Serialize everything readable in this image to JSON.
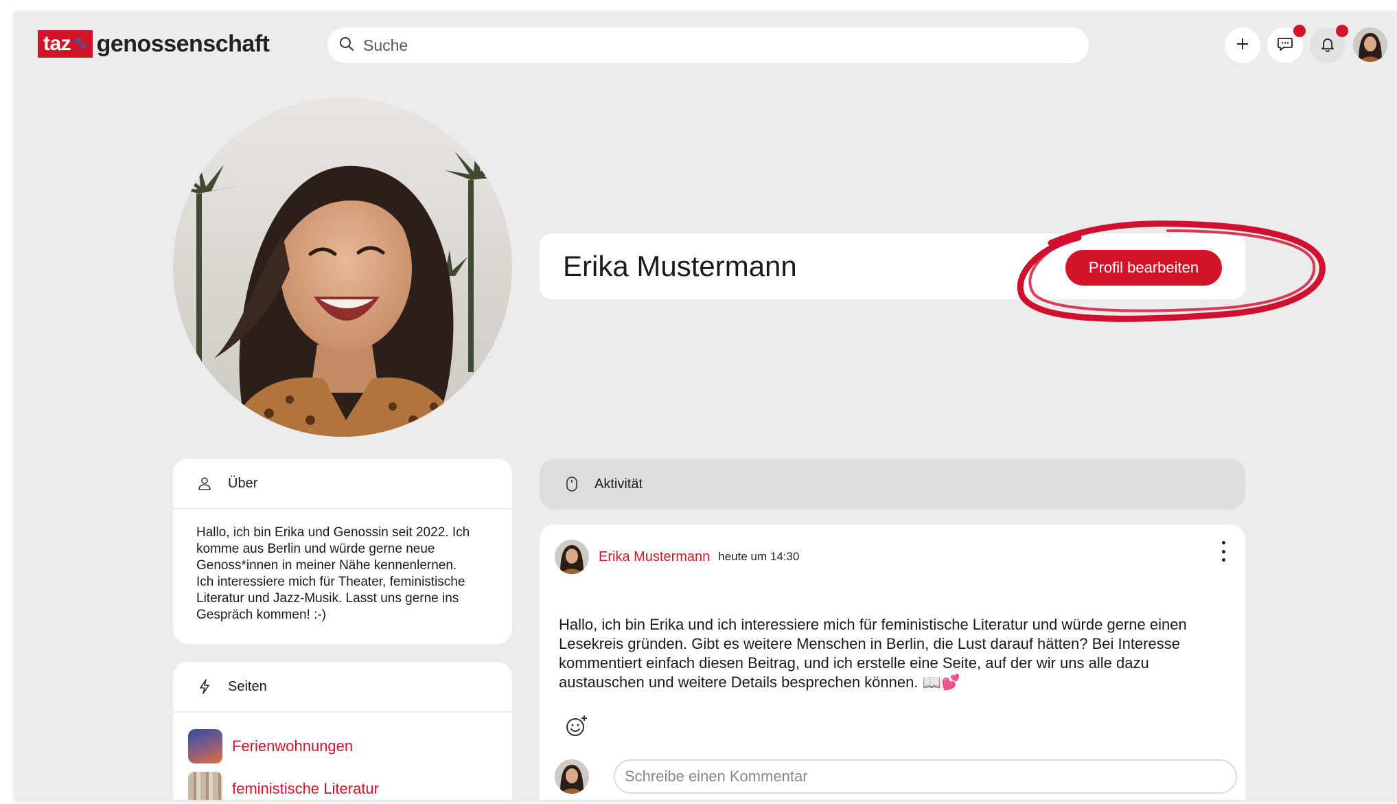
{
  "header": {
    "logo_taz": "taz",
    "logo_text": "genossenschaft",
    "search_placeholder": "Suche",
    "icons": [
      "plus-icon",
      "chat-icon",
      "bell-icon"
    ],
    "notification_dots": true
  },
  "profile": {
    "name": "Erika Mustermann",
    "edit_label": "Profil bearbeiten"
  },
  "about": {
    "title": "Über",
    "text": "Hallo, ich bin Erika und Genossin seit 2022. Ich\nkomme aus Berlin und würde gerne neue\nGenoss*innen in meiner Nähe kennenlernen.\nIch interessiere mich für Theater, feministische\nLiteratur und Jazz-Musik. Lasst uns gerne ins\nGespräch kommen! :-)"
  },
  "pages": {
    "title": "Seiten",
    "items": [
      {
        "label": "Ferienwohnungen"
      },
      {
        "label": "feministische Literatur"
      }
    ]
  },
  "activity": {
    "title": "Aktivität"
  },
  "post": {
    "author": "Erika Mustermann",
    "time": "heute um 14:30",
    "text": "Hallo, ich bin Erika und ich interessiere mich für feministische Literatur und würde gerne einen Lesekreis gründen. Gibt es weitere Menschen in Berlin, die Lust darauf hätten? Bei Interesse kommentiert einfach diesen Beitrag, und ich erstelle eine Seite, auf der wir uns alle dazu austauschen und weitere Details besprechen können. 📖💕",
    "comment_placeholder": "Schreibe einen Kommentar"
  },
  "colors": {
    "accent": "#d21429",
    "background": "#ececec"
  }
}
